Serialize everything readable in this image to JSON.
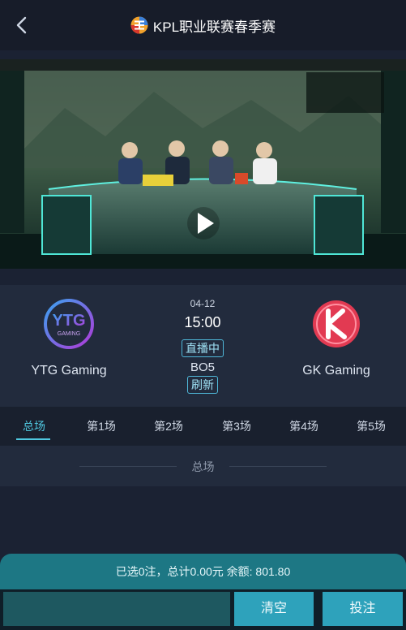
{
  "header": {
    "title": "KPL职业联赛春季赛",
    "back_icon": "chevron-left-icon",
    "logo_icon": "kpl-logo"
  },
  "video": {
    "overlay_icon": "play-icon"
  },
  "match": {
    "home": {
      "name": "YTG Gaming",
      "logo_text": "YTG"
    },
    "away": {
      "name": "GK Gaming",
      "logo_text": "K"
    },
    "date": "04-12",
    "time": "15:00",
    "status": "直播中",
    "format": "BO5",
    "refresh_label": "刷新"
  },
  "tabs": [
    "总场",
    "第1场",
    "第2场",
    "第3场",
    "第4场",
    "第5场"
  ],
  "active_tab": 0,
  "section": {
    "title": "总场"
  },
  "footer": {
    "summary": "已选0注，总计0.00元 余额: 801.80",
    "input_value": "",
    "clear_label": "清空",
    "bet_label": "投注"
  },
  "colors": {
    "accent": "#4fc8e0",
    "footer_bg": "#1d7784",
    "button": "#2ea2bb",
    "gk_red": "#e23a52",
    "ytg_purple": "#6e4de0"
  }
}
